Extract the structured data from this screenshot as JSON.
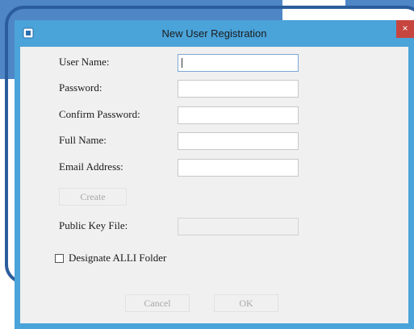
{
  "window": {
    "title": "New User Registration",
    "close_glyph": "×",
    "icon": "app-icon",
    "accent_color": "#4aa3d9",
    "close_color": "#c7453f"
  },
  "form": {
    "user_name_label": "User Name:",
    "user_name_value": "",
    "password_label": "Password:",
    "password_value": "",
    "confirm_password_label": "Confirm Password:",
    "confirm_password_value": "",
    "full_name_label": "Full Name:",
    "full_name_value": "",
    "email_label": "Email Address:",
    "email_value": "",
    "create_label": "Create",
    "public_key_label": "Public Key File:",
    "public_key_value": "",
    "designate_label": "Designate ALLI Folder",
    "designate_checked": false
  },
  "footer": {
    "cancel_label": "Cancel",
    "ok_label": "OK"
  }
}
